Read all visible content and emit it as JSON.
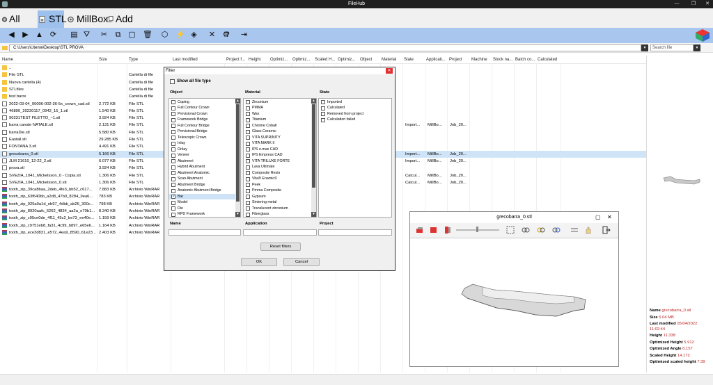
{
  "window": {
    "title": "FileHub"
  },
  "tabs": [
    {
      "label": "All files",
      "icon": "all-files-icon"
    },
    {
      "label": "STL",
      "icon": "stl-file-icon",
      "active": true
    },
    {
      "label": "MillBox",
      "icon": "millbox-icon"
    },
    {
      "label": "Add TAB ...",
      "icon": "add-tab-icon"
    }
  ],
  "path": {
    "value": "C:\\Users\\Utente\\Desktop\\STL PROVA",
    "search_placeholder": "Search file"
  },
  "columns": [
    "Name",
    "Size",
    "Type",
    "Last modified",
    "Project f...",
    "Height",
    "Optimiz...",
    "Optimiz...",
    "Scaled H...",
    "Optimiz...",
    "Object",
    "Material",
    "State",
    "Applicati...",
    "Project",
    "Machine",
    "Stock na...",
    "Batch co...",
    "Calculated"
  ],
  "files": [
    {
      "name": "..",
      "size": "",
      "type": "",
      "state": "",
      "app": "",
      "project": "",
      "icon": "folder"
    },
    {
      "name": "File STL",
      "size": "",
      "type": "Cartella di file",
      "state": "",
      "app": "",
      "project": "",
      "icon": "folder"
    },
    {
      "name": "Nuova cartella (4)",
      "size": "",
      "type": "Cartella di file",
      "state": "",
      "app": "",
      "project": "",
      "icon": "folder"
    },
    {
      "name": "STLfiles",
      "size": "",
      "type": "Cartella di file",
      "state": "",
      "app": "",
      "project": "",
      "icon": "folder"
    },
    {
      "name": "test barre",
      "size": "",
      "type": "Cartella di file",
      "state": "",
      "app": "",
      "project": "",
      "icon": "folder"
    },
    {
      "name": "2022-03-04_00006-002-36-5x_crown_cad.stl",
      "size": "2.772 KB",
      "type": "File STL",
      "state": "",
      "app": "",
      "project": "",
      "icon": "stl"
    },
    {
      "name": "46890_20230117_0942_15_1.stl",
      "size": "1.540 KB",
      "type": "File STL",
      "state": "",
      "app": "",
      "project": "",
      "icon": "stl"
    },
    {
      "name": "90231TEST FILETTO_~1.stl",
      "size": "3.924 KB",
      "type": "File STL",
      "state": "",
      "app": "",
      "project": "",
      "icon": "stl"
    },
    {
      "name": "barra canale NATALE.stl",
      "size": "2.131 KB",
      "type": "File STL",
      "state": "Import...",
      "app": "MillBo...",
      "project": "Job_20...",
      "icon": "stl"
    },
    {
      "name": "barraDie.stl",
      "size": "5.580 KB",
      "type": "File STL",
      "state": "",
      "app": "",
      "project": "",
      "icon": "stl"
    },
    {
      "name": "Eastall.stl",
      "size": "29.285 KB",
      "type": "File STL",
      "state": "",
      "app": "",
      "project": "",
      "icon": "stl"
    },
    {
      "name": "FONTANA 3.stl",
      "size": "4.491 KB",
      "type": "File STL",
      "state": "",
      "app": "",
      "project": "",
      "icon": "stl"
    },
    {
      "name": "grecobarra_0.stl",
      "size": "5.166 KB",
      "type": "File STL",
      "state": "Import...",
      "app": "MillBo...",
      "project": "Job_20...",
      "icon": "stl",
      "selected": true
    },
    {
      "name": "JLM 21610_12-22_2.stl",
      "size": "6.077 KB",
      "type": "File STL",
      "state": "Import...",
      "app": "MillBo...",
      "project": "Job_20...",
      "icon": "stl"
    },
    {
      "name": "prova.stl",
      "size": "3.924 KB",
      "type": "File STL",
      "state": "",
      "app": "",
      "project": "",
      "icon": "stl"
    },
    {
      "name": "SVEZIA_1041_Mickelsson_0 - Copia.stl",
      "size": "1.306 KB",
      "type": "File STL",
      "state": "Calcul...",
      "app": "MillBo...",
      "project": "Job_20...",
      "icon": "stl"
    },
    {
      "name": "SVEZIA_1041_Mickelsson_0.stl",
      "size": "1.306 KB",
      "type": "File STL",
      "state": "Calcul...",
      "app": "MillBo...",
      "project": "Job_20...",
      "icon": "stl"
    },
    {
      "name": "tooth_zip_39ca8baa_2deb_4fe3_bb52_c617...",
      "size": "7.883 KB",
      "type": "Archivio WinRAR",
      "state": "",
      "app": "",
      "project": "",
      "icon": "rar"
    },
    {
      "name": "tooth_zip_63f640bb_a2d8_47b0_8284_9ea6...",
      "size": "783 KB",
      "type": "Archivio WinRAR",
      "state": "",
      "app": "",
      "project": "",
      "icon": "rar"
    },
    {
      "name": "tooth_zip_925a0a1d_eb97_4dbb_ab26_300c...",
      "size": "798 KB",
      "type": "Archivio WinRAR",
      "state": "",
      "app": "",
      "project": "",
      "icon": "rar"
    },
    {
      "name": "tooth_zip_8920aafc_5262_4834_aa2a_e70b1...",
      "size": "8.340 KB",
      "type": "Archivio WinRAR",
      "state": "",
      "app": "",
      "project": "",
      "icon": "rar"
    },
    {
      "name": "tooth_zip_c95ce0de_4f11_45c2_be73_ee40e...",
      "size": "1.159 KB",
      "type": "Archivio WinRAR",
      "state": "",
      "app": "",
      "project": "",
      "icon": "rar"
    },
    {
      "name": "tooth_zip_c9751eb8_fa31_4c99_b897_e65e6...",
      "size": "1.164 KB",
      "type": "Archivio WinRAR",
      "state": "",
      "app": "",
      "project": "",
      "icon": "rar"
    },
    {
      "name": "tooth_zip_ece3d831_e572_4ea9_8590_61e23...",
      "size": "2.403 KB",
      "type": "Archivio WinRAR",
      "state": "",
      "app": "",
      "project": "",
      "icon": "rar"
    }
  ],
  "info": {
    "name_label": "Name",
    "name": "grecobarra_0.stl",
    "size_label": "Size",
    "size": "5.04 MB",
    "modified_label": "Last modified",
    "modified_date": "05/04/2022",
    "modified_time": "11:02:44",
    "height_label": "Height",
    "height": "11.338",
    "opt_height_label": "Optimized Height",
    "opt_height": "5.912",
    "opt_angle_label": "Optimized Angle",
    "opt_angle": "8.157",
    "scaled_height_label": "Scaled Height",
    "scaled_height": "14.172",
    "opt_scaled_label": "Optimized scaled height",
    "opt_scaled": "7.39"
  },
  "filter": {
    "title": "Filter",
    "show_all": "Show all file type",
    "object_label": "Object",
    "material_label": "Material",
    "state_label": "State",
    "objects": [
      "Coping",
      "Full Contour Crown",
      "Provisional Crown",
      "Framework Bridge",
      "Full Contour Bridge",
      "Provisional Bridge",
      "Telescopic Crown",
      "Inlay",
      "Onlay",
      "Veneer",
      "Abutment",
      "Hybrid Abutment",
      "Abutment Anatomic",
      "Scan Abutment",
      "Abutment Bridge",
      "Anatomic Abutment Bridge",
      "Bar",
      "Model",
      "Die",
      "RPD Framework"
    ],
    "checked_object": "Bar",
    "materials": [
      "Zirconium",
      "PMMA",
      "Wax",
      "Titanium",
      "Chrome Cobalt",
      "Glass Ceramic",
      "VITA SUPRINITY",
      "VITA MARK II",
      "IPS e.max CAD",
      "IPS Empress CAD",
      "VITA TRILUXE FORTE",
      "Lava Ultimate",
      "Composite Resin",
      "Vita® Enamic©",
      "Peek",
      "Pmma Composite",
      "Gypsum",
      "Sintering metal",
      "Translucent zirconium",
      "Fiberglass"
    ],
    "states": [
      "Imported",
      "Calculated",
      "Removed from project",
      "Calculation failed"
    ],
    "name_label": "Name",
    "application_label": "Application",
    "project_label": "Project",
    "reset": "Reset filters",
    "ok": "OK",
    "cancel": "Cancel"
  },
  "preview": {
    "title": "grecobarra_0.stl"
  },
  "colors": {
    "tab_active": "#9dc1ec",
    "toolbar": "#a9c6ee",
    "selected_row": "#d0e4f8",
    "value_red": "#b22222"
  }
}
